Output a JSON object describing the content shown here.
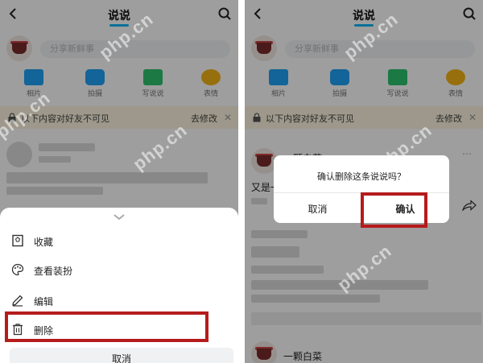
{
  "left": {
    "header": {
      "title": "说说"
    },
    "composer": {
      "placeholder": "分享新鲜事"
    },
    "actions": [
      {
        "label": "相片",
        "icon": "photo-icon"
      },
      {
        "label": "拍摄",
        "icon": "camera-icon"
      },
      {
        "label": "写说说",
        "icon": "chat-icon"
      },
      {
        "label": "表情",
        "icon": "emoji-icon"
      }
    ],
    "banner": {
      "text": "以下内容对好友不可见",
      "action": "去修改",
      "close": "✕"
    },
    "sheet": {
      "items": [
        {
          "label": "收藏",
          "icon": "bookmark-icon"
        },
        {
          "label": "查看装扮",
          "icon": "palette-icon"
        },
        {
          "label": "编辑",
          "icon": "edit-icon"
        },
        {
          "label": "删除",
          "icon": "trash-icon"
        }
      ],
      "cancel": "取消"
    }
  },
  "right": {
    "header": {
      "title": "说说"
    },
    "composer": {
      "placeholder": "分享新鲜事"
    },
    "actions": [
      {
        "label": "相片",
        "icon": "photo-icon"
      },
      {
        "label": "拍摄",
        "icon": "camera-icon"
      },
      {
        "label": "写说说",
        "icon": "chat-icon"
      },
      {
        "label": "表情",
        "icon": "emoji-icon"
      }
    ],
    "banner": {
      "text": "以下内容对好友不可见",
      "action": "去修改",
      "close": "✕"
    },
    "feed": {
      "post1_user": "一颗白菜",
      "post1_text": "又是一",
      "post2_user": "一颗白菜"
    },
    "dialog": {
      "message": "确认删除这条说说吗？",
      "cancel": "取消",
      "confirm": "确认"
    }
  },
  "watermark": "php.cn",
  "colors": {
    "accent": "#12b7f5",
    "highlight": "#b51c1c",
    "banner_bg": "#fdf6e0"
  }
}
